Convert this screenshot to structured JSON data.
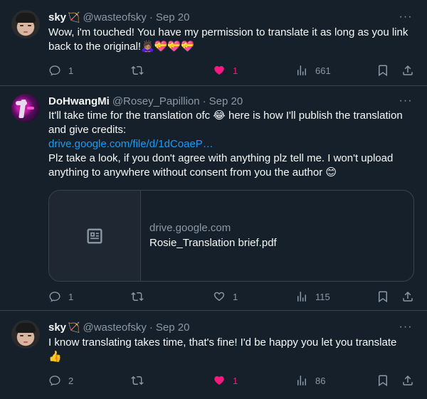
{
  "tweets": [
    {
      "name": "sky",
      "badge": "🏹",
      "handle": "@wasteofsky",
      "date": "Sep 20",
      "text": "Wow, i'm touched! You have my permission to translate it as long as you link back to the original!🙇🏽‍♀️💝💝💝",
      "replies": "1",
      "retweets": "",
      "likes": "1",
      "liked": true,
      "views": "661"
    },
    {
      "name": "DoHwangMi",
      "handle": "@Rosey_Papillion",
      "date": "Sep 20",
      "text_line1": "It'll take time for the translation ofc 😂 here is how I'll publish the translation and give credits:",
      "link": "drive.google.com/file/d/1dCoaeP…",
      "text_line2": "Plz take a look, if you don't agree with anything plz tell me. I won't upload anything to anywhere without consent from you the author 😊",
      "card": {
        "domain": "drive.google.com",
        "title": "Rosie_Translation brief.pdf"
      },
      "replies": "1",
      "retweets": "",
      "likes": "1",
      "liked": false,
      "views": "115"
    },
    {
      "name": "sky",
      "badge": "🏹",
      "handle": "@wasteofsky",
      "date": "Sep 20",
      "text": "I know translating takes time, that's fine! I'd be happy you let you translate 👍",
      "replies": "2",
      "retweets": "",
      "likes": "1",
      "liked": true,
      "views": "86"
    }
  ],
  "separator": "·",
  "more_label": "···",
  "colors": {
    "background": "#15202b",
    "accent": "#1d9bf0",
    "like": "#f91880",
    "muted": "#8b98a5",
    "border": "#38444d"
  }
}
